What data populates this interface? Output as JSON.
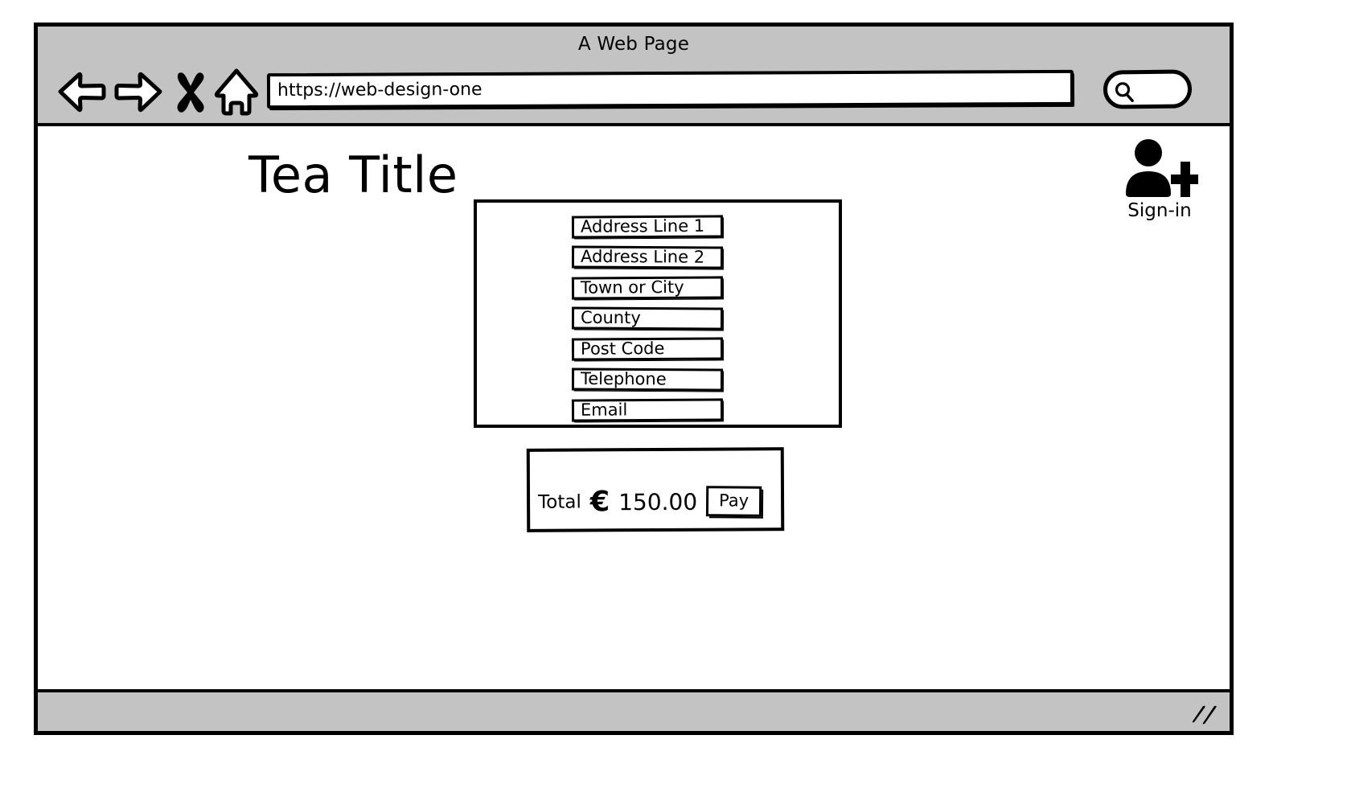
{
  "browser": {
    "window_title": "A Web Page",
    "nav": {
      "back_icon": "back-arrow-icon",
      "forward_icon": "forward-arrow-icon",
      "stop_icon": "stop-x-icon",
      "home_icon": "home-icon"
    },
    "url_bar": {
      "value": "https://web-design-one",
      "placeholder": "https://"
    },
    "search": {
      "icon": "search-magnifier-icon",
      "value": "",
      "placeholder": ""
    },
    "statusbar": {
      "resize_grip_icon": "resize-grip-icon"
    }
  },
  "page": {
    "heading": "Tea Title",
    "signin": {
      "icon": "user-add-icon",
      "label": "Sign-in"
    },
    "address_form": {
      "fields": [
        {
          "label": "Address Line 1"
        },
        {
          "label": "Address Line 2"
        },
        {
          "label": "Town or City"
        },
        {
          "label": "County"
        },
        {
          "label": "Post Code"
        },
        {
          "label": "Telephone"
        },
        {
          "label": "Email"
        }
      ]
    },
    "checkout": {
      "total_label": "Total",
      "currency_symbol": "€",
      "amount": "150.00",
      "pay_label": "Pay"
    }
  },
  "colors": {
    "chrome_gray": "#c3c3c3",
    "ink": "#000000",
    "page_background": "#ffffff"
  }
}
